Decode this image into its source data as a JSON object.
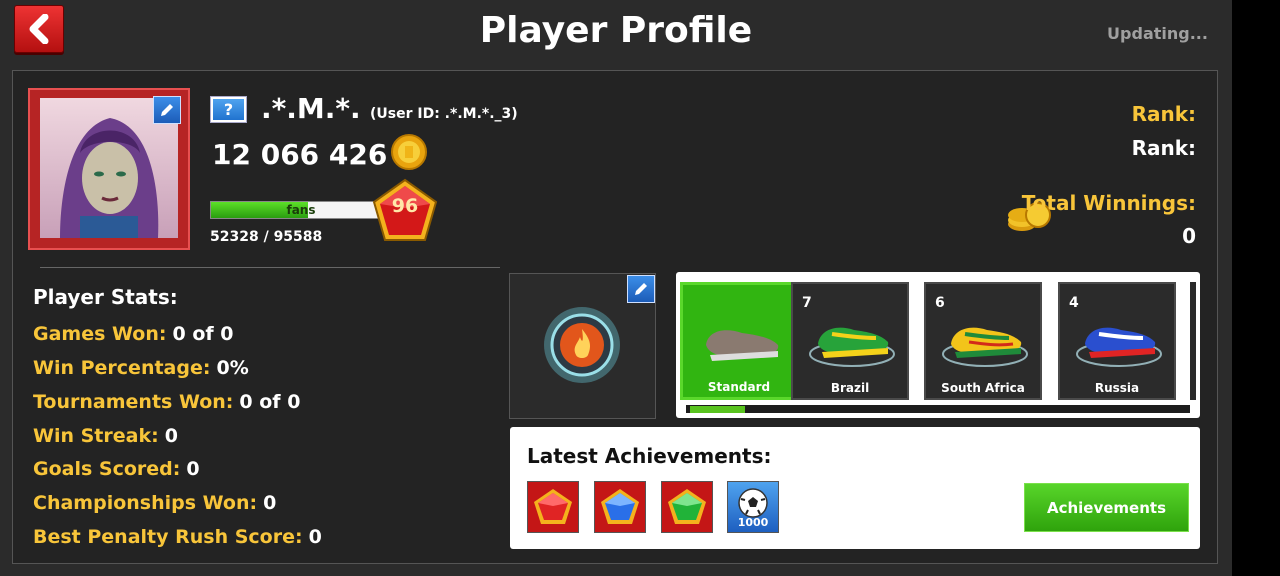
{
  "header": {
    "title": "Player Profile",
    "status": "Updating..."
  },
  "profile": {
    "country_flag": "?",
    "username": ".*.M.*.",
    "user_id": "(User ID: .*.M.*._3)",
    "coins": "12 066 426",
    "fans_label": "fans",
    "fans_progress": "52328 / 95588",
    "fans_fraction": 0.547,
    "level": "96"
  },
  "rank": {
    "rank_label_1": "Rank:",
    "rank_label_2": "Rank:",
    "total_winnings_label": "Total Winnings:",
    "total_winnings_value": "0"
  },
  "stats": {
    "title": "Player Stats:",
    "items": [
      {
        "label": "Games Won:",
        "value": "0 of 0"
      },
      {
        "label": "Win Percentage:",
        "value": "0%"
      },
      {
        "label": "Tournaments Won:",
        "value": "0 of 0"
      },
      {
        "label": "Win Streak:",
        "value": "0"
      },
      {
        "label": "Goals Scored:",
        "value": "0"
      },
      {
        "label": "Championships Won:",
        "value": "0"
      },
      {
        "label": "Best Penalty Rush Score:",
        "value": "0"
      }
    ]
  },
  "cleats": [
    {
      "name": "Standard",
      "count": "",
      "selected": true,
      "colors": [
        "#8a7a70",
        "#ddd"
      ]
    },
    {
      "name": "Brazil",
      "count": "7",
      "selected": false,
      "colors": [
        "#27a33a",
        "#f4d21a"
      ]
    },
    {
      "name": "South Africa",
      "count": "6",
      "selected": false,
      "colors": [
        "#f2c41a",
        "#1f8a3a"
      ]
    },
    {
      "name": "Russia",
      "count": "4",
      "selected": false,
      "colors": [
        "#2a4fcf",
        "#e02424"
      ]
    }
  ],
  "achievements": {
    "title": "Latest Achievements:",
    "button": "Achievements",
    "items": [
      {
        "icon": "red-gem-icon",
        "color": "#e02424"
      },
      {
        "icon": "blue-gem-icon",
        "color": "#2a6fe8"
      },
      {
        "icon": "green-gem-icon",
        "color": "#21b339"
      },
      {
        "icon": "soccer-ball-icon",
        "badge": "1000"
      }
    ]
  },
  "colors": {
    "accent_yellow": "#f8c53a",
    "button_green": "#3fbb16",
    "back_red": "#d01a1a"
  }
}
